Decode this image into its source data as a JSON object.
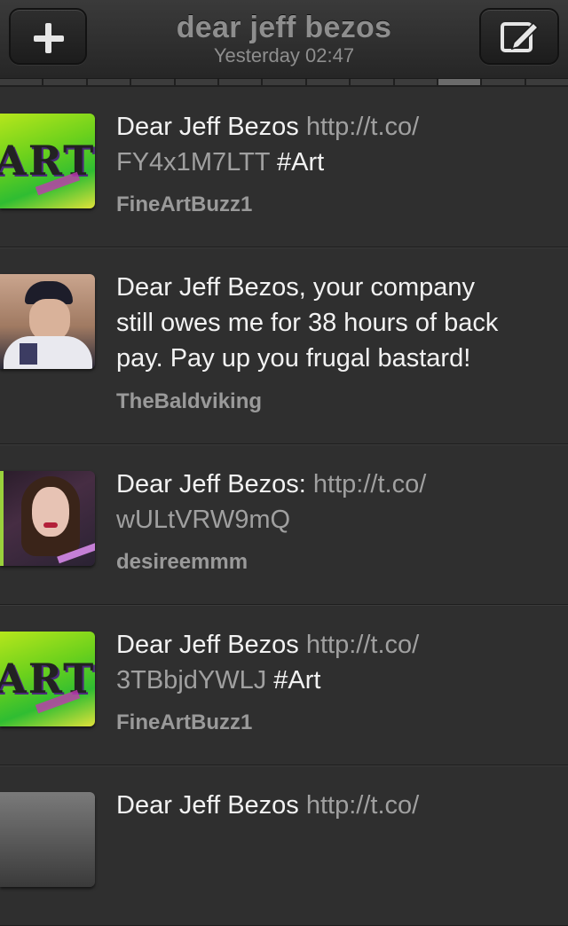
{
  "header": {
    "title": "dear jeff bezos",
    "subtitle": "Yesterday 02:47",
    "left_button_icon": "plus-icon",
    "right_button_icon": "compose-icon"
  },
  "pager": {
    "segments": 13,
    "active_index": 10
  },
  "tweets": [
    {
      "text_before": "Dear Jeff Bezos ",
      "link": "http://t.co/ FY4x1M7LTT",
      "link_line1": "http://t.co/",
      "link_line2": "FY4x1M7LTT",
      "hashtag": "#Art",
      "handle": "FineArtBuzz1"
    },
    {
      "line1": "Dear Jeff Bezos, your company",
      "line2": "still owes me for 38 hours of back",
      "line3": "pay.  Pay up you frugal bastard!",
      "handle": "TheBaldviking"
    },
    {
      "text_before": "Dear Jeff Bezos: ",
      "link_line1": "http://t.co/",
      "link_line2": "wULtVRW9mQ",
      "handle": "desireemmm"
    },
    {
      "text_before": "Dear Jeff Bezos ",
      "link_line1": "http://t.co/",
      "link_line2": "3TBbjdYWLJ",
      "hashtag": "#Art",
      "handle": "FineArtBuzz1"
    },
    {
      "text_before": "Dear Jeff Bezos ",
      "link_line1": "http://t.co/"
    }
  ],
  "colors": {
    "background": "#2f2f2f",
    "text": "#f2f2f2",
    "link": "#a0a0a0",
    "handle": "#9a9a9a"
  }
}
